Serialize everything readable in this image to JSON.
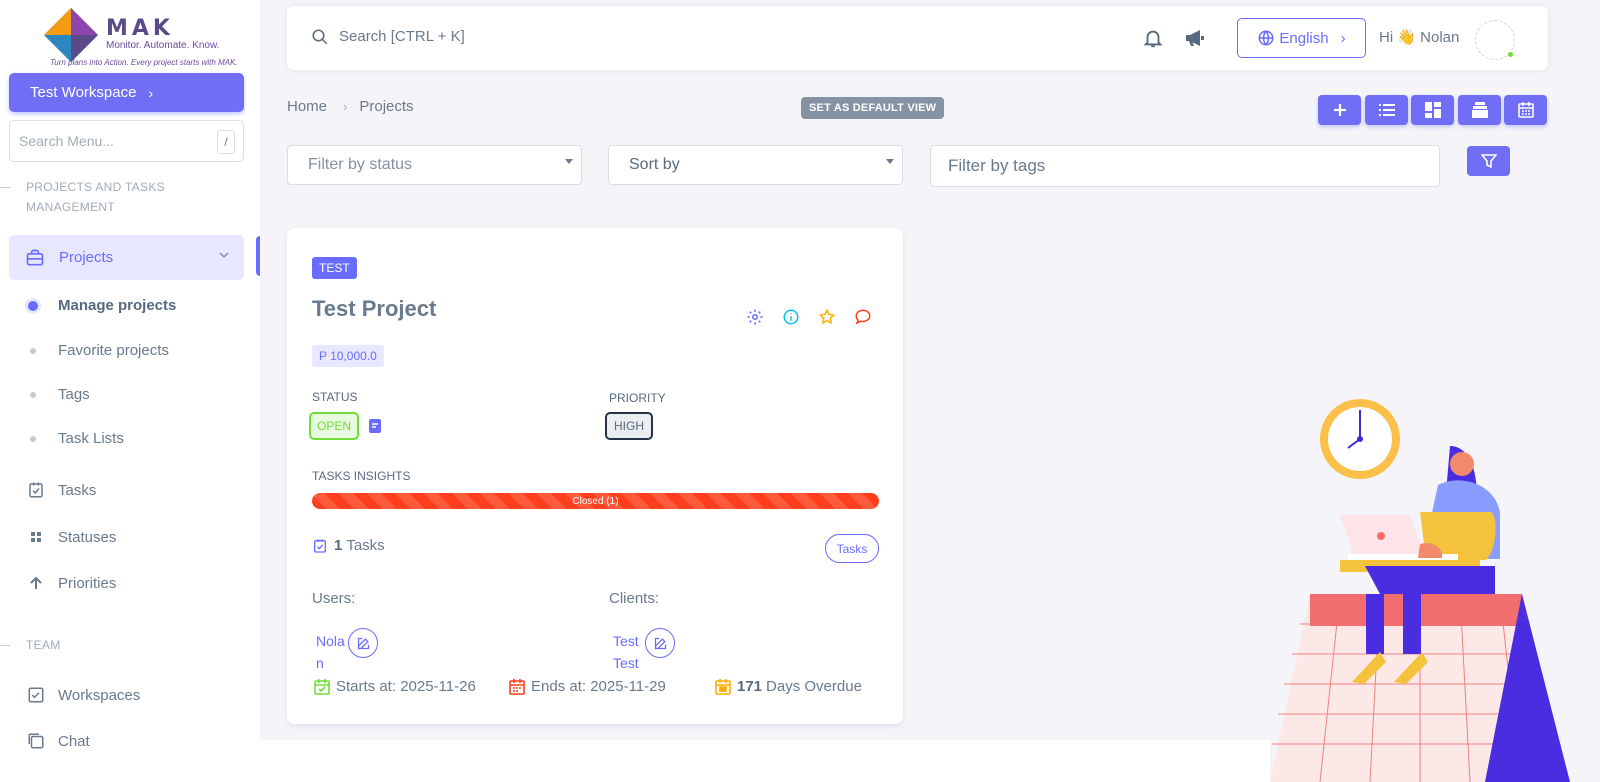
{
  "brand": {
    "name": "MAK",
    "subtitle": "Monitor. Automate. Know.",
    "tagline": "Turn plans into Action. Every project starts with MAK."
  },
  "sidebar": {
    "workspace_label": "Test Workspace",
    "search_placeholder": "Search Menu...",
    "search_shortcut": "/",
    "section_projects_line1": "PROJECTS AND TASKS",
    "section_projects_line2": "MANAGEMENT",
    "projects_label": "Projects",
    "sub_items": [
      "Manage projects",
      "Favorite projects",
      "Tags",
      "Task Lists"
    ],
    "items": [
      "Tasks",
      "Statuses",
      "Priorities"
    ],
    "section_team": "TEAM",
    "team_items": [
      "Workspaces",
      "Chat"
    ]
  },
  "navbar": {
    "search_placeholder": "Search [CTRL + K]",
    "language": "English",
    "greeting": "Hi 👋 Nolan"
  },
  "breadcrumb": {
    "home": "Home",
    "current": "Projects"
  },
  "toolbar": {
    "default_view": "SET AS DEFAULT VIEW"
  },
  "filters": {
    "status_placeholder": "Filter by status",
    "sort_placeholder": "Sort by",
    "tags_placeholder": "Filter by tags"
  },
  "project": {
    "tag": "TEST",
    "title": "Test Project",
    "budget": "P 10,000.0",
    "status_label": "STATUS",
    "status": "OPEN",
    "priority_label": "PRIORITY",
    "priority": "HIGH",
    "insights_label": "TASKS INSIGHTS",
    "progress_label": "Closed (1)",
    "progress_percent": 100,
    "tasks_count": "1",
    "tasks_word": "Tasks",
    "tasks_button": "Tasks",
    "users_label": "Users:",
    "clients_label": "Clients:",
    "user_alt": "Nolan",
    "client_alt": "Test Test",
    "starts_at": "Starts at: 2025-11-26",
    "ends_at": "Ends at: 2025-11-29",
    "overdue_days": "171",
    "overdue_text": "Days Overdue"
  },
  "colors": {
    "primary": "#696cff",
    "success": "#71dd37",
    "danger": "#ff3e1d",
    "warning": "#ffab00",
    "info": "#03c3ec"
  },
  "icons": [
    "search-icon",
    "bell-icon",
    "megaphone-icon",
    "globe-icon",
    "briefcase-icon",
    "task-icon",
    "grid-icon",
    "arrow-up-icon",
    "workspace-icon",
    "chat-icon",
    "gear-icon",
    "info-icon",
    "star-icon",
    "comment-icon",
    "note-icon",
    "calendar-icon",
    "filter-icon"
  ]
}
